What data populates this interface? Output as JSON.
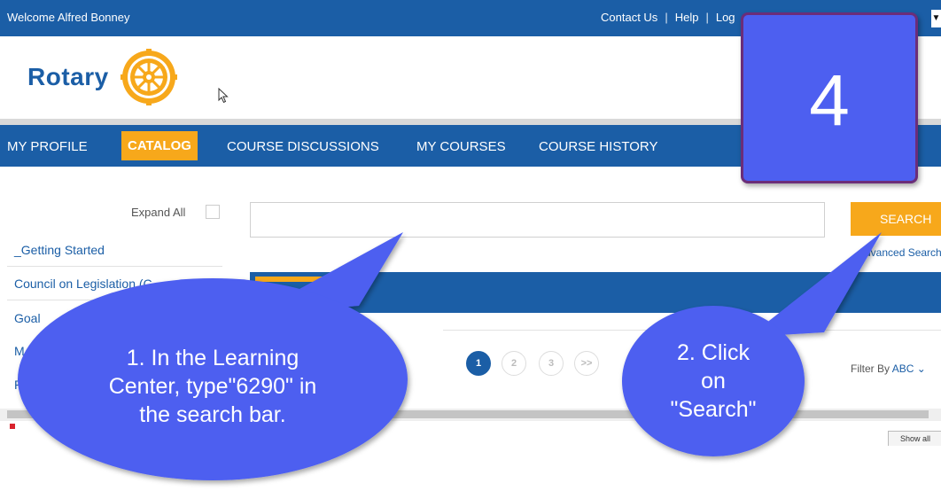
{
  "topbar": {
    "welcome": "Welcome Alfred Bonney",
    "contact": "Contact Us",
    "sep": "|",
    "help": "Help",
    "logout": "Log"
  },
  "brand": {
    "logo_text": "Rotary",
    "colors": {
      "primary": "#1b5ea6",
      "accent": "#f7a81b",
      "callout": "#4d5ff0"
    }
  },
  "nav": {
    "items": [
      {
        "label": "MY PROFILE"
      },
      {
        "label": "CATALOG",
        "active": true
      },
      {
        "label": "COURSE DISCUSSIONS"
      },
      {
        "label": "MY COURSES"
      },
      {
        "label": "COURSE HISTORY"
      }
    ]
  },
  "sidebar": {
    "expand_all": "Expand All",
    "items": [
      {
        "label": "_Getting Started"
      },
      {
        "label": "Council on Legislation (C"
      },
      {
        "label": "Goal"
      },
      {
        "label": "M"
      },
      {
        "label": "R"
      }
    ]
  },
  "search": {
    "value": "",
    "placeholder": "",
    "button": "SEARCH",
    "advanced": "Advanced Search"
  },
  "pagination": {
    "pages": [
      "1",
      "2",
      "3",
      ">>"
    ],
    "current": "1"
  },
  "filter": {
    "label": "Filter By",
    "value": "ABC"
  },
  "footer": {
    "show_all": "Show all"
  },
  "step": {
    "number": "4"
  },
  "callouts": {
    "one": [
      "1.  In the Learning",
      "Center, type\"6290\" in",
      "the search bar."
    ],
    "two": [
      "2.  Click",
      "on",
      "\"Search\""
    ]
  }
}
